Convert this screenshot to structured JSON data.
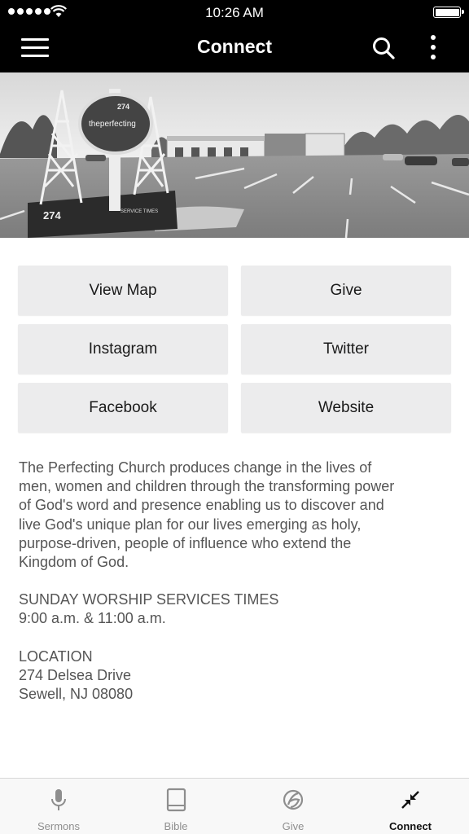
{
  "status_bar": {
    "time": "10:26 AM",
    "signal_bars": 5,
    "battery_level": 1.0
  },
  "nav": {
    "title": "Connect"
  },
  "hero": {
    "sign_top_number": "274",
    "sign_logo_text": "theperfecting",
    "sign_base_number": "274",
    "sign_service_text": "SERVICE TIMES"
  },
  "buttons": {
    "view_map": "View Map",
    "give": "Give",
    "instagram": "Instagram",
    "twitter": "Twitter",
    "facebook": "Facebook",
    "website": "Website"
  },
  "about": {
    "description_lines": [
      "The Perfecting Church produces change in the lives of",
      "men, women and children through the transforming power",
      "of God's word and presence enabling us to discover and",
      "live God's unique plan for our lives emerging as holy,",
      "purpose-driven, people of influence who extend the",
      "Kingdom of God."
    ],
    "services_heading": "SUNDAY WORSHIP SERVICES TIMES",
    "services_times": "9:00 a.m. & 11:00 a.m.",
    "location_heading": "LOCATION",
    "location_street": "274 Delsea Drive",
    "location_city": "Sewell, NJ 08080"
  },
  "tabs": [
    {
      "label": "Sermons",
      "icon": "microphone-icon",
      "active": false
    },
    {
      "label": "Bible",
      "icon": "book-icon",
      "active": false
    },
    {
      "label": "Give",
      "icon": "give-icon",
      "active": false
    },
    {
      "label": "Connect",
      "icon": "collapse-arrows-icon",
      "active": true
    }
  ],
  "colors": {
    "bar_background": "#000000",
    "button_background": "#ececed",
    "body_text": "#555555",
    "tab_inactive": "#8e8e8e",
    "tab_active": "#111111"
  }
}
